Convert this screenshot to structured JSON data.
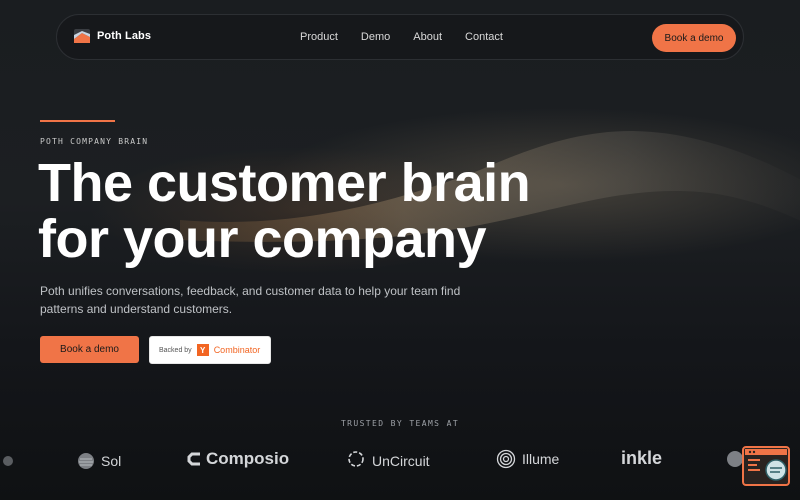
{
  "nav": {
    "brand": "Poth Labs",
    "links": [
      "Product",
      "Demo",
      "About",
      "Contact"
    ],
    "cta": "Book a demo"
  },
  "hero": {
    "eyebrow": "POTH COMPANY BRAIN",
    "headline_line1": "The customer brain",
    "headline_line2": "for your company",
    "subtext": "Poth unifies conversations, feedback, and customer data to help your team find patterns and understand customers.",
    "cta": "Book a demo",
    "badge": {
      "prefix": "Backed by",
      "letter": "Y",
      "name": "Combinator"
    }
  },
  "trusted": {
    "label": "TRUSTED BY TEAMS AT",
    "logos": [
      "Sol",
      "Composio",
      "UnCircuit",
      "Illume",
      "inkle"
    ]
  },
  "colors": {
    "accent": "#f07447",
    "background": "#111316",
    "yc_orange": "#f26522"
  }
}
